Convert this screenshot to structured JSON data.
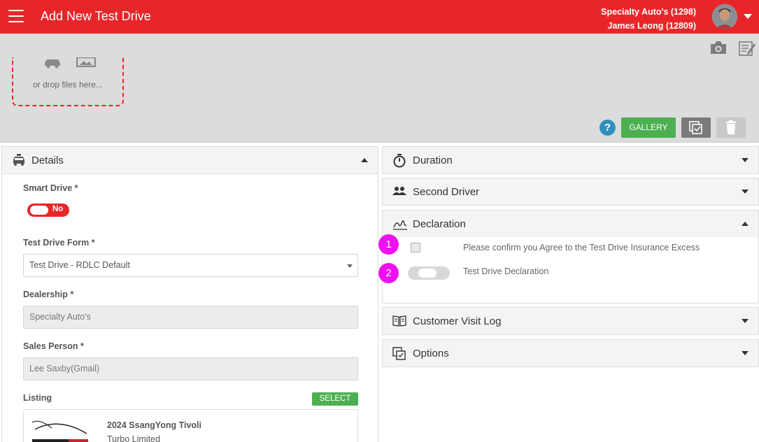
{
  "header": {
    "title": "Add New Test Drive",
    "account_line1": "Specialty Auto's (1298)",
    "account_line2": "James Leong (12809)",
    "menu_icon": "hamburger-icon",
    "avatar_icon": "user-avatar",
    "brand_color": "#e8262a"
  },
  "media": {
    "drop_text": "or drop files here...",
    "gallery_label": "GALLERY",
    "help_label": "?",
    "camera_icon": "camera-icon",
    "notes_icon": "notepad-icon"
  },
  "details": {
    "title": "Details",
    "smart_drive_label": "Smart Drive *",
    "smart_drive_value": "No",
    "test_drive_form_label": "Test Drive Form *",
    "test_drive_form_value": "Test Drive - RDLC Default",
    "dealership_label": "Dealership *",
    "dealership_value": "Specialty Auto's",
    "sales_person_label": "Sales Person *",
    "sales_person_value": "Lee Saxby(Gmail)",
    "listing_label": "Listing",
    "select_label": "SELECT",
    "listing_title": "2024 SsangYong Tivoli",
    "listing_sub": "Turbo Limited"
  },
  "accordions": {
    "duration": "Duration",
    "second_driver": "Second Driver",
    "declaration": "Declaration",
    "customer_visit_log": "Customer Visit Log",
    "options": "Options"
  },
  "declaration": {
    "marker1": "1",
    "marker2": "2",
    "agree_text": "Please confirm you Agree to the Test Drive Insurance Excess",
    "declaration_text": "Test Drive Declaration",
    "marker_color": "#ee10ee"
  }
}
